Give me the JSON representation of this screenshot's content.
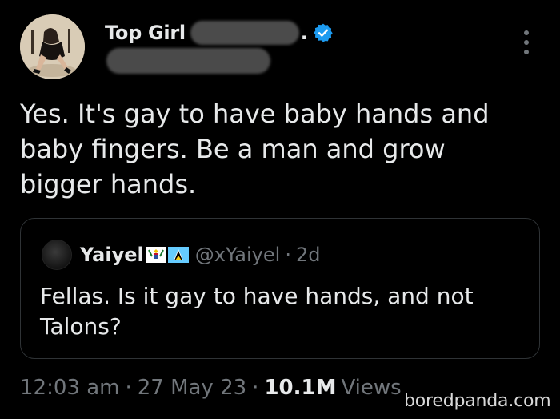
{
  "tweet": {
    "author": {
      "display_name": "Top Girl",
      "name_suffix": ".",
      "verified_icon": "verified-badge-icon",
      "verified_color": "#1d9bf0"
    },
    "more_icon": "more-options-icon",
    "text": "Yes. It's gay to have baby hands and baby fingers. Be a man and grow bigger hands.",
    "quoted": {
      "display_name": "Yaiyel",
      "flag_icons": [
        "us-virgin-islands-flag-icon",
        "saint-lucia-flag-icon"
      ],
      "handle": "@xYaiyel",
      "separator": "·",
      "time": "2d",
      "text": "Fellas. Is it gay to have hands, and not Talons?"
    },
    "meta": {
      "time": "12:03 am",
      "separator": "·",
      "date": "27 May 23",
      "views_count": "10.1M",
      "views_label": "Views"
    }
  },
  "watermark": "boredpanda.com",
  "colors": {
    "background": "#000000",
    "text": "#e7e9ea",
    "muted": "#71767b",
    "border": "#2f3336"
  }
}
